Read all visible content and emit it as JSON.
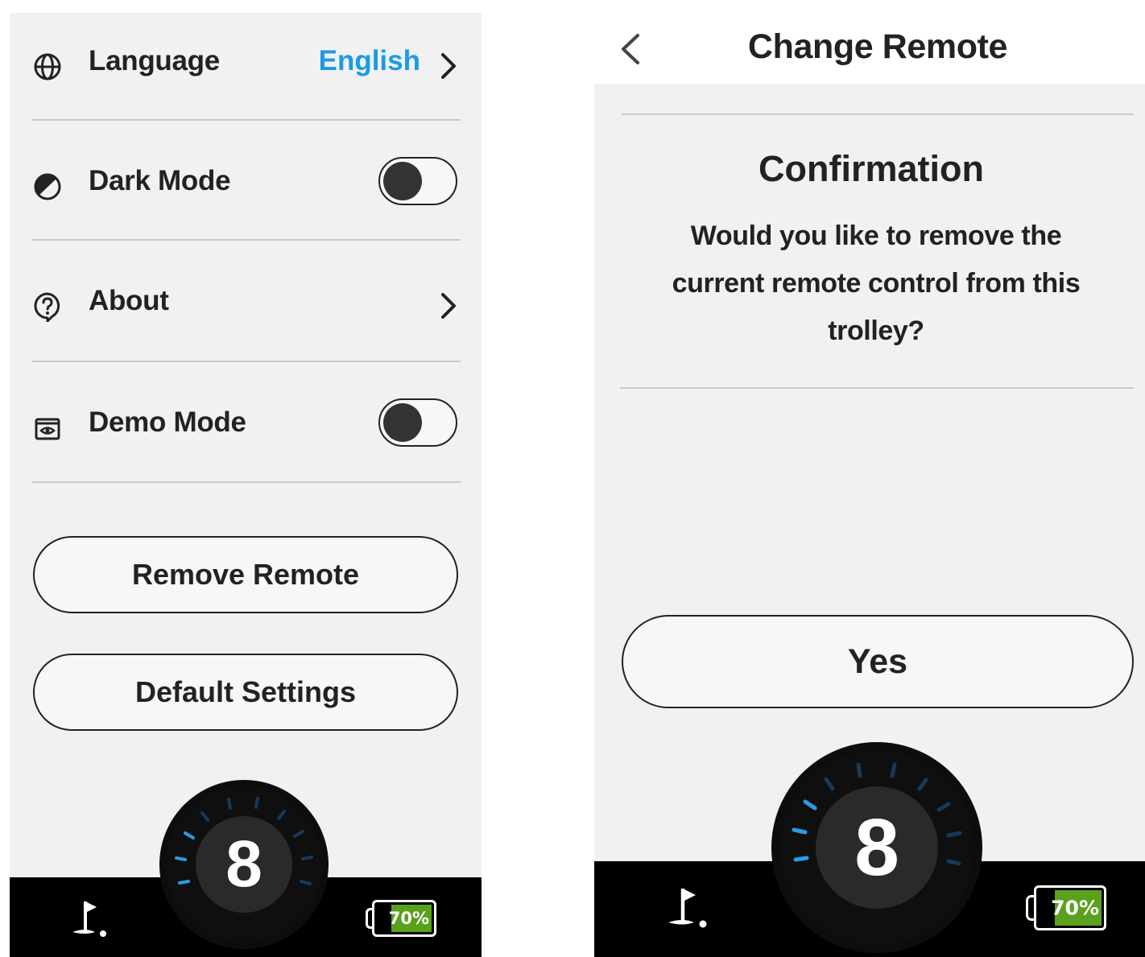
{
  "settings_screen": {
    "rows": [
      {
        "label": "Language",
        "value": "English",
        "icon": "globe-icon"
      },
      {
        "label": "Dark Mode",
        "icon": "half-circle-icon",
        "toggle": "off"
      },
      {
        "label": "About",
        "icon": "question-bubble-icon"
      },
      {
        "label": "Demo Mode",
        "icon": "eye-box-icon",
        "toggle": "off"
      }
    ],
    "remove_remote_label": "Remove Remote",
    "default_settings_label": "Default Settings",
    "dial_number": "8",
    "battery_percent": "70%"
  },
  "remote_screen": {
    "title": "Change Remote",
    "confirm_title": "Confirmation",
    "confirm_message": "Would you like to remove the current remote control from this trolley?",
    "yes_label": "Yes",
    "dial_number": "8",
    "battery_percent": "70%"
  },
  "colors": {
    "accent": "#1a9be6",
    "battery_fill": "#5aa11c",
    "dial_tick_active": "#2a9be8",
    "dial_tick_inactive": "#143a5c"
  }
}
